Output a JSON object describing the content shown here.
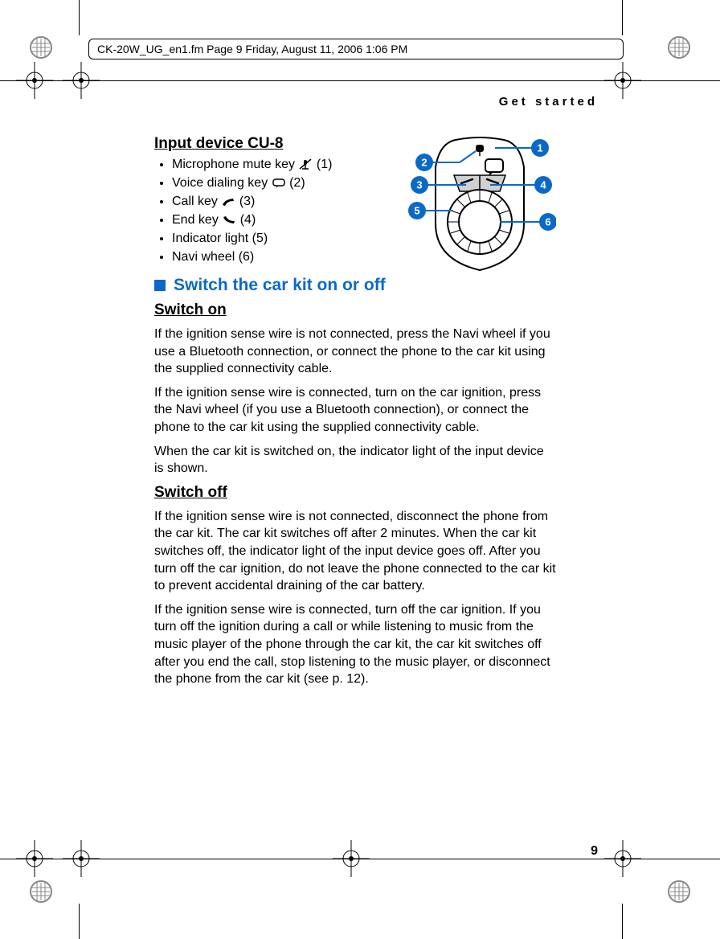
{
  "header": "CK-20W_UG_en1.fm  Page 9  Friday, August 11, 2006  1:06 PM",
  "running_head": "Get started",
  "input_device": {
    "heading": "Input device CU-8",
    "items": [
      "Microphone mute key",
      "Voice dialing key",
      "Call key",
      "End key",
      "Indicator light (5)",
      "Navi wheel (6)"
    ],
    "suffix": [
      " (1)",
      " (2)",
      " (3)",
      " (4)",
      "",
      ""
    ]
  },
  "section_title": "Switch the car kit on or off",
  "switch_on": {
    "heading": "Switch on",
    "p1": "If the ignition sense wire is not connected, press the Navi wheel if you use a Bluetooth connection, or connect the phone to the car kit using the supplied connectivity cable.",
    "p2": "If the ignition sense wire is connected, turn on the car ignition, press the Navi wheel (if you use a Bluetooth connection), or connect the phone to the car kit using the supplied connectivity cable.",
    "p3": "When the car kit is switched on, the indicator light of the input device is shown."
  },
  "switch_off": {
    "heading": "Switch off",
    "p1": "If the ignition sense wire is not connected, disconnect the phone from the car kit. The car kit switches off after 2 minutes. When the car kit switches off, the indicator light of the input device goes off. After you turn off the car ignition, do not leave the phone connected to the car kit to prevent accidental draining of the car battery.",
    "p2": "If the ignition sense wire is connected, turn off the car ignition. If you turn off the ignition during a call or while listening to music from the music player of the phone through the car kit, the car kit switches off after you end the call, stop listening to the music player, or disconnect the phone from the car kit (see p. 12)."
  },
  "page_number": "9",
  "callouts": [
    "1",
    "2",
    "3",
    "4",
    "5",
    "6"
  ]
}
